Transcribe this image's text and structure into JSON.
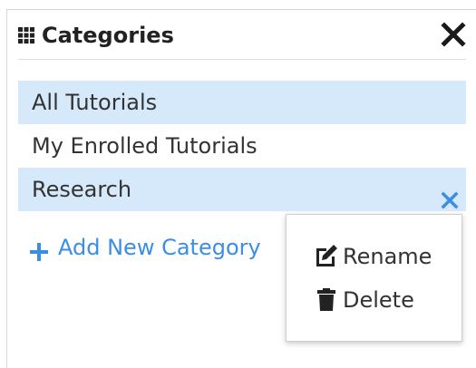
{
  "panel": {
    "title": "Categories",
    "title_icon": "grid-icon",
    "close_icon": "close-icon"
  },
  "categories": [
    {
      "label": "All Tutorials",
      "selected": true
    },
    {
      "label": "My Enrolled Tutorials",
      "selected": false
    },
    {
      "label": "Research",
      "selected": true,
      "remove_icon": "remove-icon"
    }
  ],
  "add_category": {
    "label": "Add New Category",
    "icon": "plus-icon"
  },
  "context_menu": {
    "items": [
      {
        "label": "Rename",
        "icon": "edit-icon"
      },
      {
        "label": "Delete",
        "icon": "trash-icon"
      }
    ]
  },
  "colors": {
    "selected_bg": "#d6e9fa",
    "accent": "#3a8ee6",
    "text": "#333333"
  }
}
